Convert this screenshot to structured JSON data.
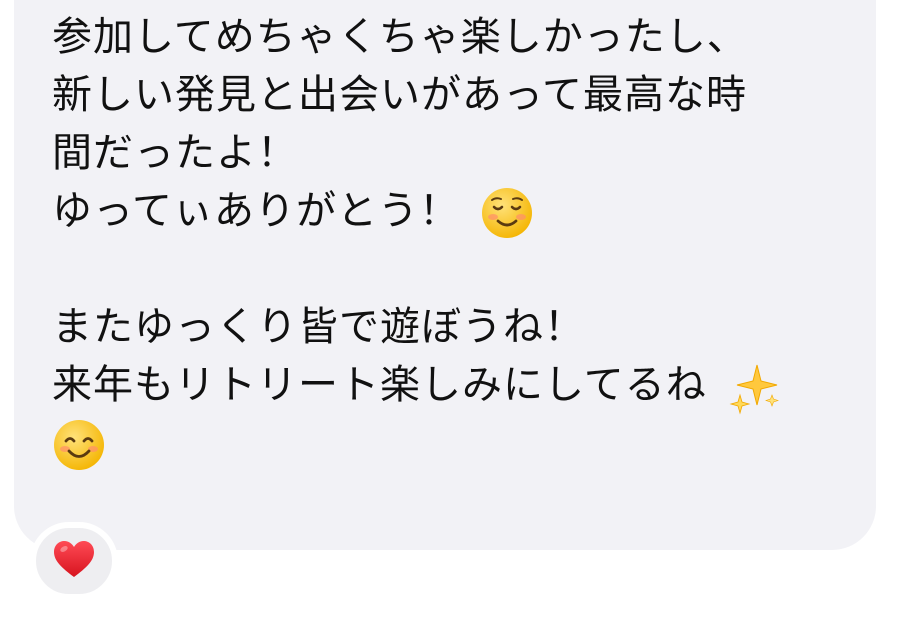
{
  "message": {
    "lines": [
      "参加してめちゃくちゃ楽しかったし、",
      "新しい発見と出会いがあって最高な時",
      "間だったよ！",
      "ゆってぃありがとう！",
      "",
      "またゆっくり皆で遊ぼうね！",
      "来年もリトリート楽しみにしてるね",
      ""
    ],
    "emojis": {
      "line4": "relieved-smile-emoji",
      "line7": "sparkles-emoji",
      "line8": "smiling-face-emoji"
    }
  },
  "reaction": {
    "icon": "red-heart-icon",
    "color": "#e8212e"
  },
  "colors": {
    "bubble": "#f2f2f6",
    "text": "#111111",
    "background": "#ffffff"
  }
}
